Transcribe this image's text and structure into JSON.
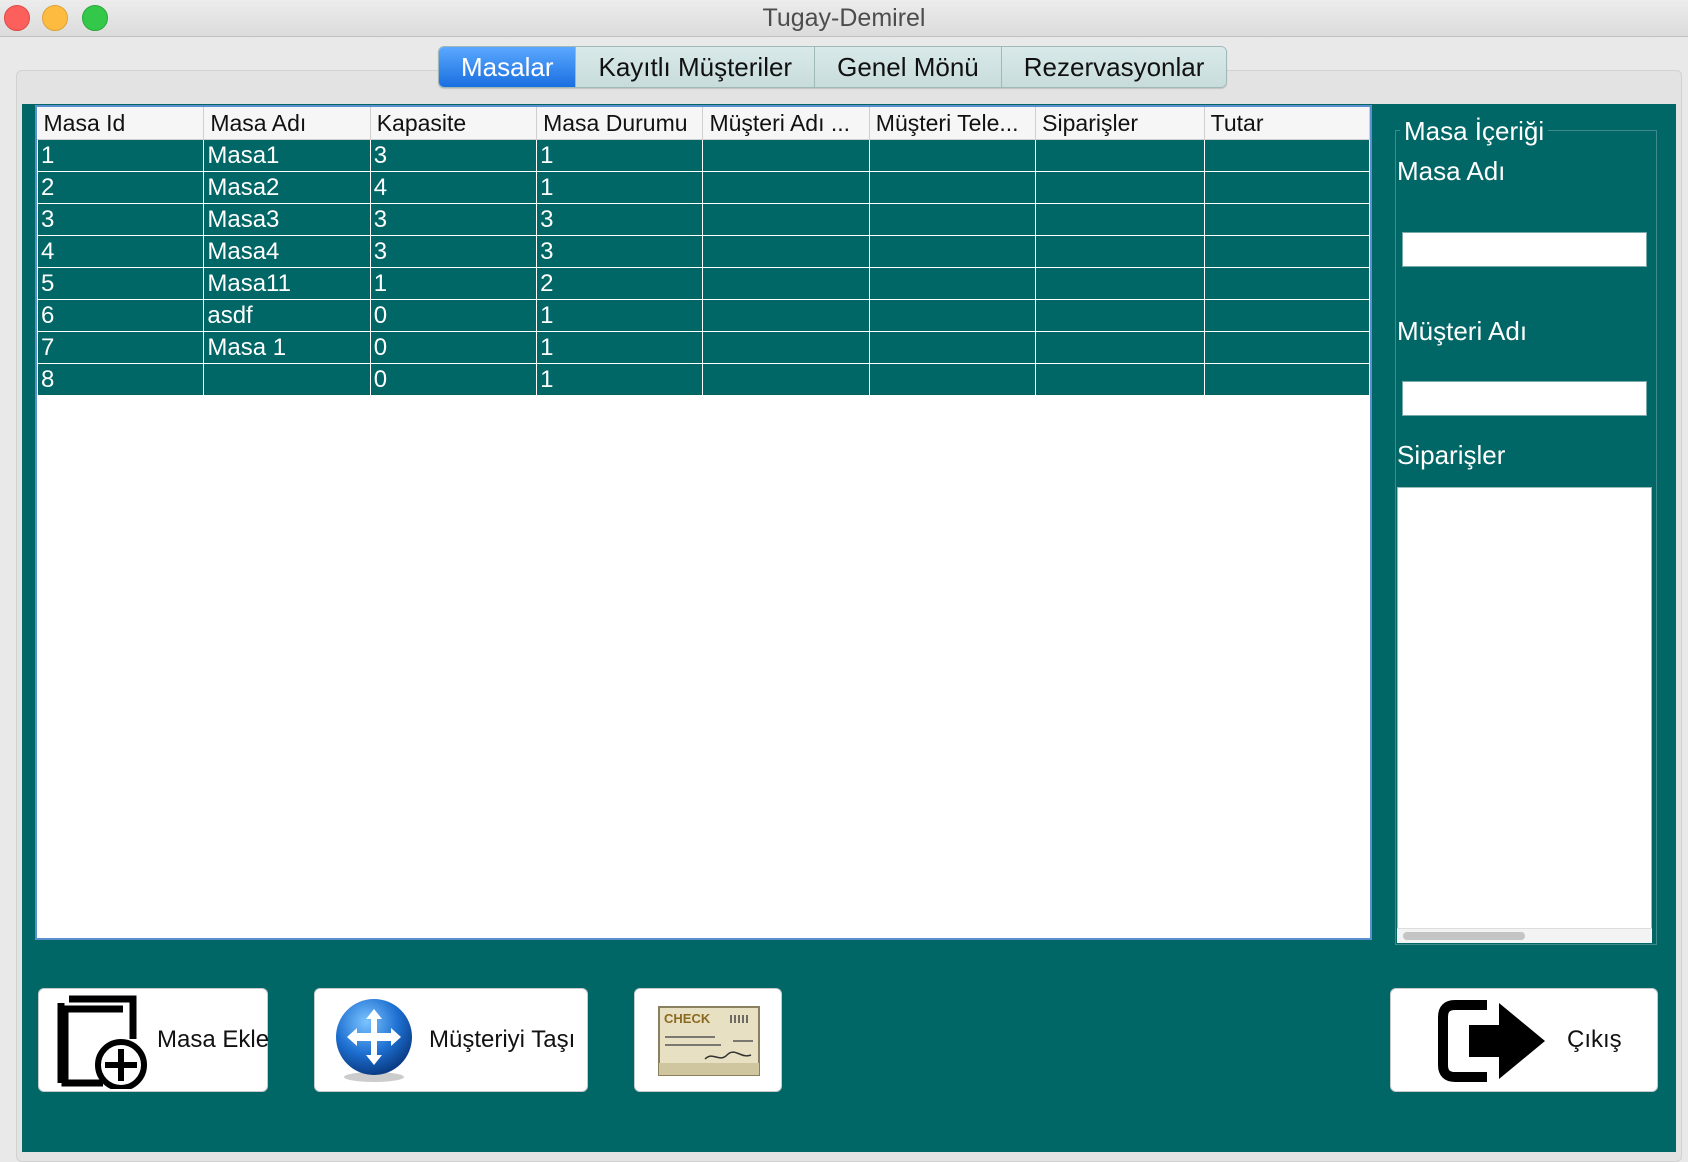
{
  "window": {
    "title": "Tugay-Demirel"
  },
  "tabs": [
    {
      "label": "Masalar",
      "active": true
    },
    {
      "label": "Kayıtlı Müşteriler",
      "active": false
    },
    {
      "label": "Genel Mönü",
      "active": false
    },
    {
      "label": "Rezervasyonlar",
      "active": false
    }
  ],
  "table": {
    "columns": [
      "Masa Id",
      "Masa Adı",
      "Kapasite",
      "Masa Durumu",
      "Müşteri Adı ...",
      "Müşteri Tele...",
      "Siparişler",
      "Tutar"
    ],
    "rows": [
      [
        "1",
        "Masa1",
        "3",
        "1",
        "",
        "",
        "",
        ""
      ],
      [
        "2",
        "Masa2",
        "4",
        "1",
        "",
        "",
        "",
        ""
      ],
      [
        "3",
        "Masa3",
        "3",
        "3",
        "",
        "",
        "",
        ""
      ],
      [
        "4",
        "Masa4",
        "3",
        "3",
        "",
        "",
        "",
        ""
      ],
      [
        "5",
        "Masa11",
        "1",
        "2",
        "",
        "",
        "",
        ""
      ],
      [
        "6",
        "asdf",
        "0",
        "1",
        "",
        "",
        "",
        ""
      ],
      [
        "7",
        "Masa 1",
        "0",
        "1",
        "",
        "",
        "",
        ""
      ],
      [
        "8",
        "",
        "0",
        "1",
        "",
        "",
        "",
        ""
      ]
    ]
  },
  "side": {
    "legend": "Masa İçeriği",
    "masa_adi_label": "Masa Adı",
    "musteri_adi_label": "Müşteri Adı",
    "siparisler_label": "Siparişler",
    "masa_adi_value": "",
    "musteri_adi_value": "",
    "siparisler_value": ""
  },
  "buttons": {
    "masa_ekle": "Masa Ekle",
    "musteriyi_tasi": "Müşteriyi Taşı",
    "check_icon_text": "CHECK",
    "cikis": "Çıkış"
  },
  "colors": {
    "panel": "#006666",
    "active_tab": "#1a6fe0",
    "tab": "#c8dcdc"
  }
}
